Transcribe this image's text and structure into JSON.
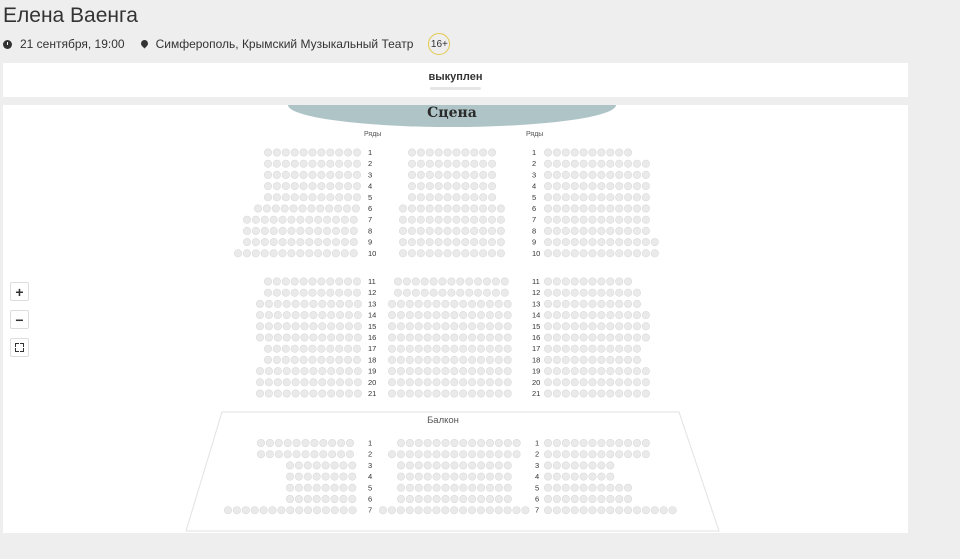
{
  "event": {
    "title": "Елена Ваенга",
    "datetime": "21 сентября, 19:00",
    "venue": "Симферополь, Крымский Музыкальный Театр",
    "age_rating": "16+"
  },
  "status": {
    "label": "выкуплен"
  },
  "hall": {
    "stage_label": "Сцена",
    "rows_caption": "Ряды",
    "balcony_label": "Балкон",
    "parterre_rows": [
      "1",
      "2",
      "3",
      "4",
      "5",
      "6",
      "7",
      "8",
      "9",
      "10",
      "11",
      "12",
      "13",
      "14",
      "15",
      "16",
      "17",
      "18",
      "19",
      "20",
      "21"
    ],
    "balcony_rows": [
      "1",
      "2",
      "3",
      "4",
      "5",
      "6",
      "7"
    ]
  },
  "controls": {
    "zoom_in": "+",
    "zoom_out": "−"
  },
  "colors": {
    "stage": "#afc4c7",
    "seat_fill": "#eaeaea",
    "seat_stroke": "#dadada",
    "age_border": "#e3c84a"
  },
  "icons": [
    "clock-icon",
    "map-pin-icon",
    "zoom-in-icon",
    "zoom-out-icon",
    "fullscreen-icon"
  ]
}
